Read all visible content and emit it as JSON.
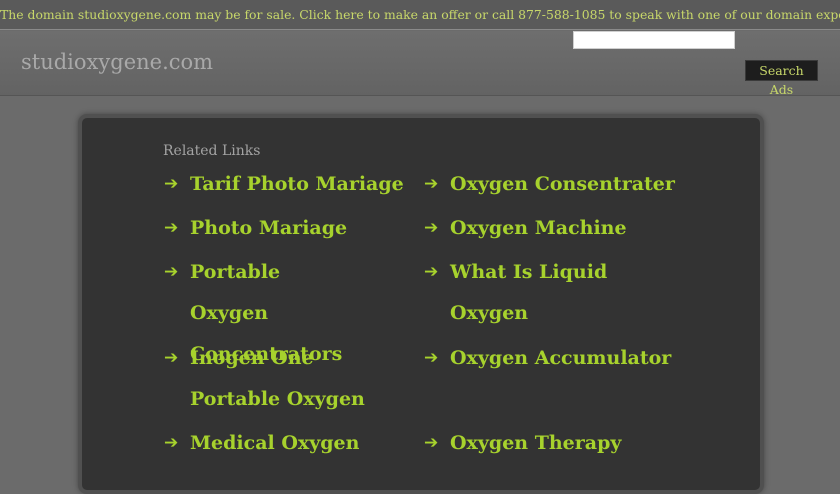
{
  "topbar": {
    "offer_text": "The domain studioxygene.com may be for sale. Click here to make an offer or call 877-588-1085 to speak with one of our domain experts."
  },
  "header": {
    "site_title": "studioxygene.com",
    "search_placeholder": "",
    "search_button_label": "Search Ads"
  },
  "main": {
    "related_heading": "Related Links",
    "links_left": [
      "Tarif Photo Mariage",
      "Photo Mariage",
      "Portable Oxygen Concentrators",
      "Inogen One Portable Oxygen",
      "Medical Oxygen"
    ],
    "links_right": [
      "Oxygen Consentrater",
      "Oxygen Machine",
      "What Is Liquid Oxygen",
      "Oxygen Accumulator",
      "Oxygen Therapy"
    ],
    "arrow_glyph": "➔"
  },
  "colors": {
    "accent": "#a7d22d",
    "topbar_text": "#c8d86a",
    "panel_bg": "#333333",
    "page_bg": "#6b6b6b"
  }
}
